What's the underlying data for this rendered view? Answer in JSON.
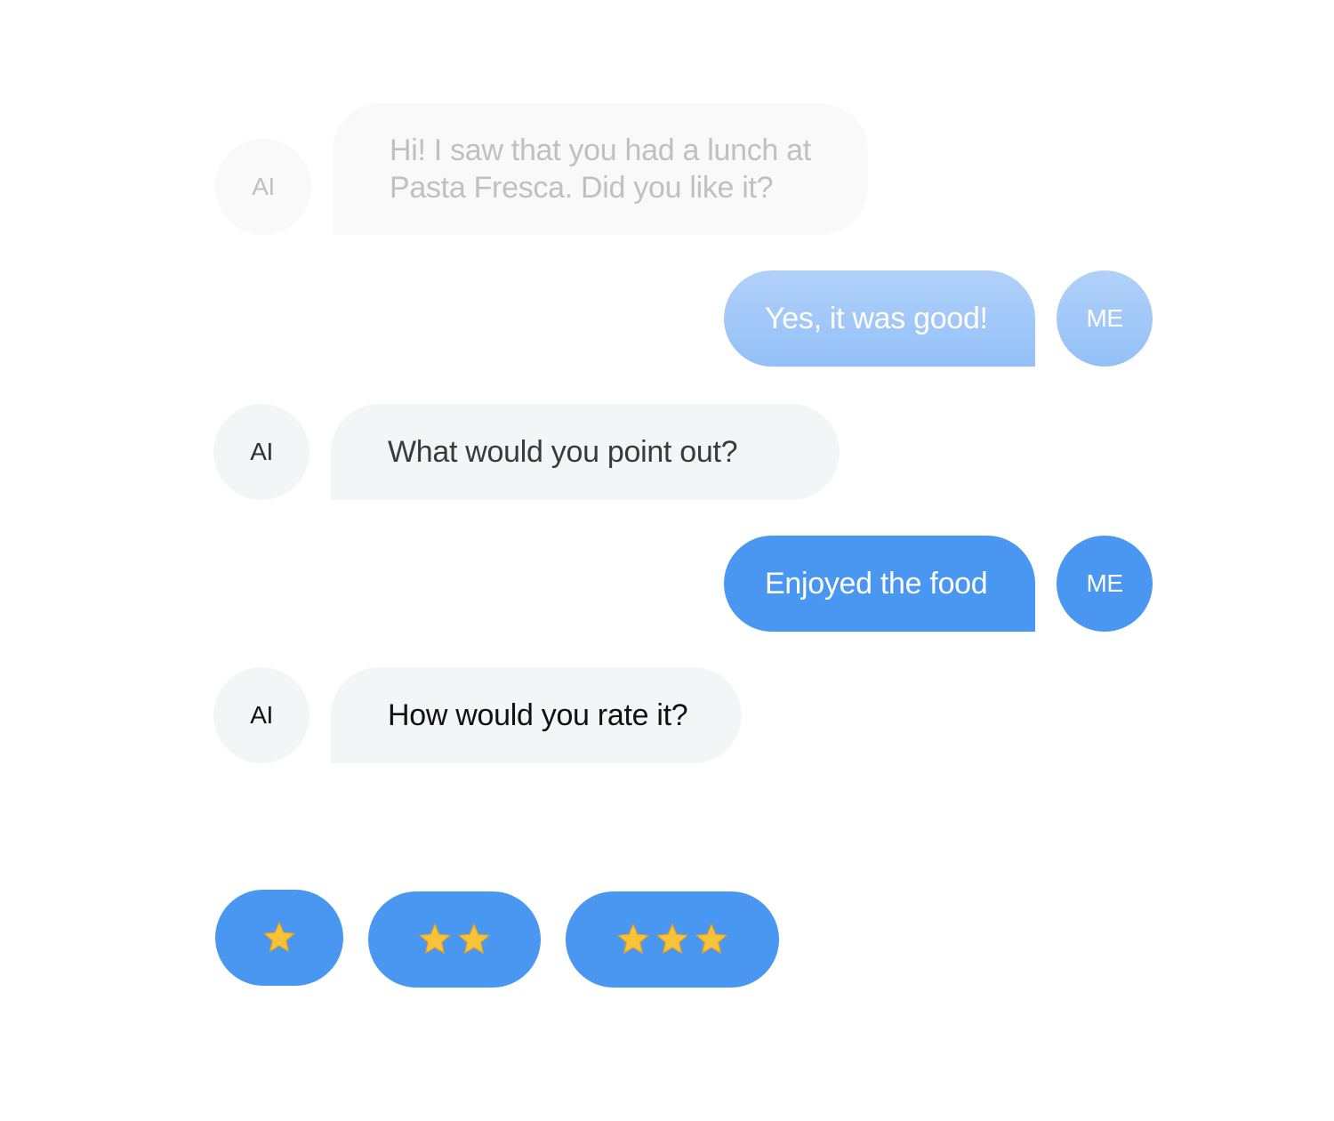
{
  "conversation": {
    "messages": [
      {
        "sender": "AI",
        "text": "Hi! I saw that you had a lunch at Pasta Fresca. Did you like it?"
      },
      {
        "sender": "ME",
        "text": "Yes, it was good!"
      },
      {
        "sender": "AI",
        "text": "What would you point out?"
      },
      {
        "sender": "ME",
        "text": "Enjoyed the food"
      },
      {
        "sender": "AI",
        "text": "How would you rate it?"
      }
    ]
  },
  "rating": {
    "options": [
      {
        "stars": 1,
        "icon": "star-icon"
      },
      {
        "stars": 2,
        "icon": "star-icon"
      },
      {
        "stars": 3,
        "icon": "star-icon"
      }
    ]
  },
  "colors": {
    "accent_blue": "#4a97f1",
    "light_blue_top": "#b1d1f9",
    "light_blue_bottom": "#94c0f7",
    "ai_bubble": "#f4f5f7",
    "star_gold": "#f7c33a"
  }
}
